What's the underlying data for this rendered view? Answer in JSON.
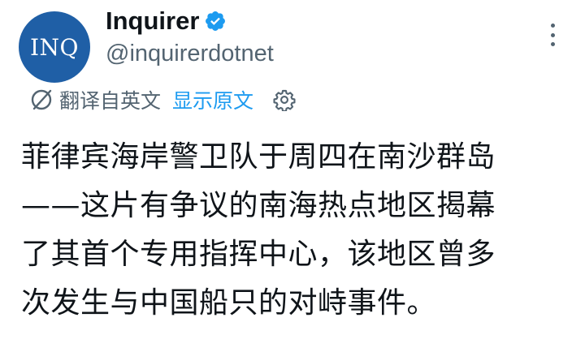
{
  "author": {
    "avatar_text": "INQ",
    "display_name": "Inquirer",
    "handle": "@inquirerdotnet",
    "verified": true
  },
  "translation": {
    "translated_from_label": "翻译自英文",
    "show_original_label": "显示原文"
  },
  "tweet": {
    "text": "菲律宾海岸警卫队于周四在南沙群岛\n——这片有争议的南海热点地区揭幕\n了其首个专用指挥中心，该地区曾多\n次发生与中国船只的对峙事件。"
  },
  "icons": {
    "verified": "verified-badge-icon",
    "no_translate": "translate-slash-icon",
    "settings": "gear-icon",
    "more": "more-vertical-icon"
  },
  "colors": {
    "avatar_bg": "#1f5fa6",
    "link_blue": "#1d9bf0",
    "secondary_gray": "#536471",
    "text_primary": "#0f1419"
  }
}
